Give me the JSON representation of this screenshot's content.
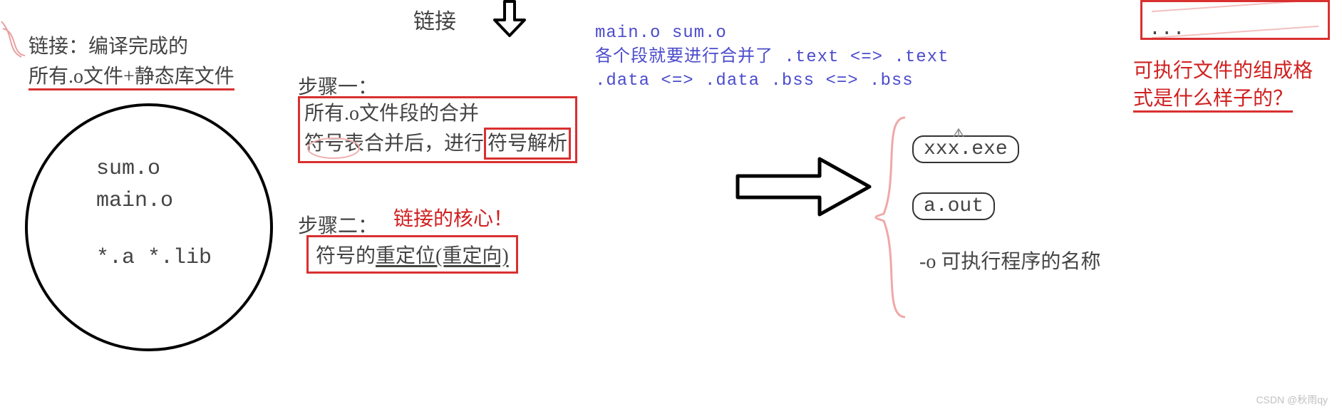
{
  "header": {
    "link_label": "链接"
  },
  "left": {
    "title_1": "链接：编译完成的",
    "title_2": "所有.o文件+静态库文件",
    "circle": {
      "sum": "sum.o",
      "main": "main.o",
      "libs": "*.a  *.lib"
    }
  },
  "steps": {
    "step1_label": "步骤一：",
    "step1_line1": "所有.o文件段的合并",
    "step1_line2_prefix": "符号表合并后，进行",
    "step1_line2_box": "符号解析",
    "step2_label": "步骤二：",
    "step2_note": "链接的核心！",
    "step2_box_prefix": "符号的",
    "step2_box_underlined": "重定位(重定向)"
  },
  "merge": {
    "line1": "main.o sum.o",
    "line2": "各个段就要进行合并了 .text <=> .text",
    "line3": ".data <=> .data    .bss <=> .bss"
  },
  "scribble": {
    "dots": "..."
  },
  "right": {
    "question_l1": "可执行文件的组成格",
    "question_l2": "式是什么样子的？",
    "exe": "xxx.exe",
    "aout": "a.out",
    "opt": "-o 可执行程序的名称"
  },
  "watermark": "CSDN @秋雨qy"
}
